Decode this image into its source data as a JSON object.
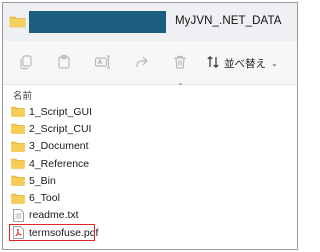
{
  "window": {
    "title": "MyJVN_.NET_DATA"
  },
  "toolbar": {
    "buttons": [
      {
        "name": "copy-path-icon"
      },
      {
        "name": "paste-icon"
      },
      {
        "name": "cut-icon"
      },
      {
        "name": "rename-icon"
      },
      {
        "name": "share-icon"
      },
      {
        "name": "delete-icon"
      }
    ],
    "sort_label": "並べ替え"
  },
  "columns": {
    "name": "名前"
  },
  "files": [
    {
      "label": "1_Script_GUI",
      "type": "folder"
    },
    {
      "label": "2_Script_CUI",
      "type": "folder"
    },
    {
      "label": "3_Document",
      "type": "folder"
    },
    {
      "label": "4_Reference",
      "type": "folder"
    },
    {
      "label": "5_Bin",
      "type": "folder"
    },
    {
      "label": "6_Tool",
      "type": "folder"
    },
    {
      "label": "readme.txt",
      "type": "text"
    },
    {
      "label": "termsofuse.pdf",
      "type": "pdf",
      "highlighted": true
    }
  ],
  "colors": {
    "folder": "#f3c44a",
    "redaction": "#1b5e80",
    "highlight_border": "#e0262b"
  }
}
